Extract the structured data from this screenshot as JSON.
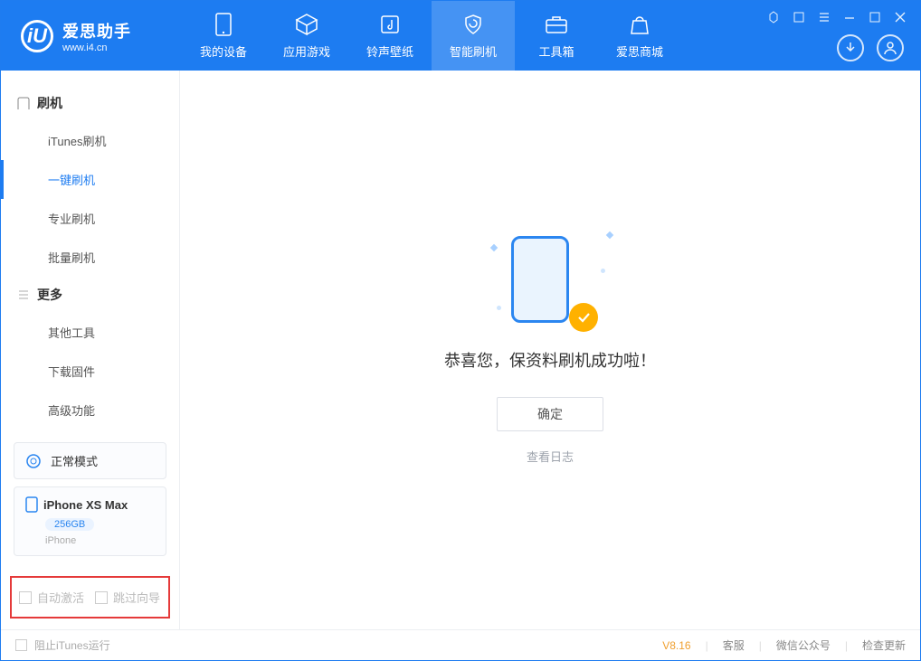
{
  "app": {
    "title": "爱思助手",
    "subtitle": "www.i4.cn"
  },
  "nav": {
    "items": [
      {
        "label": "我的设备"
      },
      {
        "label": "应用游戏"
      },
      {
        "label": "铃声壁纸"
      },
      {
        "label": "智能刷机"
      },
      {
        "label": "工具箱"
      },
      {
        "label": "爱思商城"
      }
    ]
  },
  "sidebar": {
    "group_flash": "刷机",
    "items_flash": [
      "iTunes刷机",
      "一键刷机",
      "专业刷机",
      "批量刷机"
    ],
    "group_more": "更多",
    "items_more": [
      "其他工具",
      "下载固件",
      "高级功能"
    ],
    "mode_box": "正常模式",
    "device": {
      "name": "iPhone XS Max",
      "storage": "256GB",
      "type": "iPhone"
    },
    "highlight": {
      "auto_activate": "自动激活",
      "skip_guide": "跳过向导"
    }
  },
  "main": {
    "success": "恭喜您，保资料刷机成功啦！",
    "ok": "确定",
    "view_log": "查看日志"
  },
  "footer": {
    "block_itunes": "阻止iTunes运行",
    "version": "V8.16",
    "support": "客服",
    "wechat": "微信公众号",
    "update": "检查更新"
  }
}
